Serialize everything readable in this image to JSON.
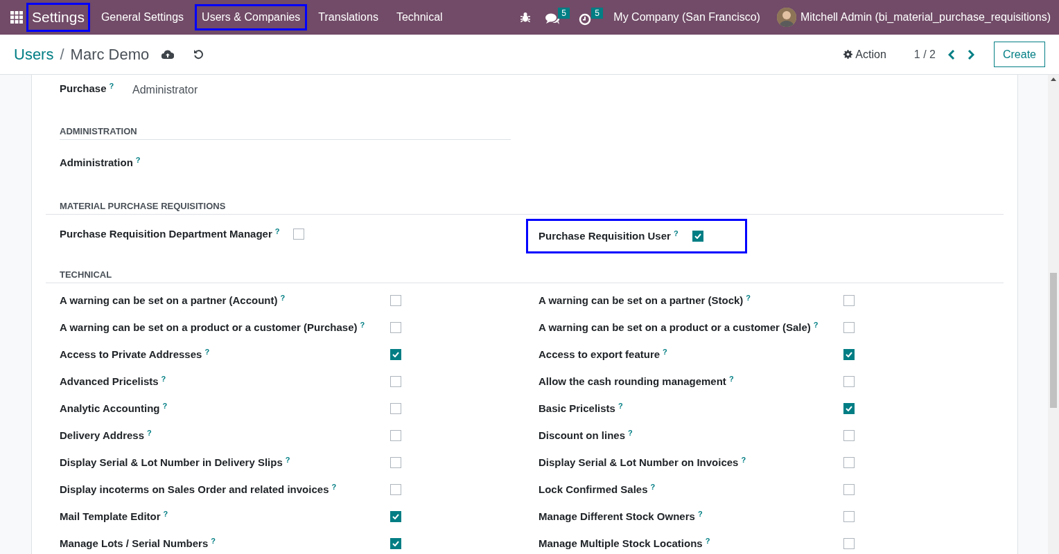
{
  "navbar": {
    "app": {
      "label": "Settings",
      "highlighted": true
    },
    "menu": [
      {
        "label": "General Settings",
        "highlighted": false
      },
      {
        "label": "Users & Companies",
        "highlighted": true
      },
      {
        "label": "Translations",
        "highlighted": false
      },
      {
        "label": "Technical",
        "highlighted": false
      }
    ],
    "messages_badge": "5",
    "activities_badge": "5",
    "company": "My Company (San Francisco)",
    "user": "Mitchell Admin (bi_material_purchase_requisitions)"
  },
  "control_panel": {
    "breadcrumb": [
      "Users",
      "Marc Demo"
    ],
    "separator": "/",
    "action": "Action",
    "pager": "1 / 2",
    "create": "Create"
  },
  "purchase": {
    "label": "Purchase",
    "help": "?",
    "value": "Administrator"
  },
  "administration": {
    "title": "ADMINISTRATION",
    "label": "Administration",
    "help": "?"
  },
  "material": {
    "title": "MATERIAL PURCHASE REQUISITIONS",
    "fields": [
      {
        "label": "Purchase Requisition Department Manager",
        "help": "?",
        "checked": false,
        "highlighted": false
      },
      {
        "label": "Purchase Requisition User",
        "help": "?",
        "checked": true,
        "highlighted": true
      }
    ]
  },
  "technical": {
    "title": "TECHNICAL",
    "fields": [
      {
        "label": "A warning can be set on a partner (Account)",
        "help": "?",
        "checked": false
      },
      {
        "label": "A warning can be set on a partner (Stock)",
        "help": "?",
        "checked": false
      },
      {
        "label": "A warning can be set on a product or a customer (Purchase)",
        "help": "?",
        "checked": false
      },
      {
        "label": "A warning can be set on a product or a customer (Sale)",
        "help": "?",
        "checked": false
      },
      {
        "label": "Access to Private Addresses",
        "help": "?",
        "checked": true
      },
      {
        "label": "Access to export feature",
        "help": "?",
        "checked": true
      },
      {
        "label": "Advanced Pricelists",
        "help": "?",
        "checked": false
      },
      {
        "label": "Allow the cash rounding management",
        "help": "?",
        "checked": false
      },
      {
        "label": "Analytic Accounting",
        "help": "?",
        "checked": false
      },
      {
        "label": "Basic Pricelists",
        "help": "?",
        "checked": true
      },
      {
        "label": "Delivery Address",
        "help": "?",
        "checked": false
      },
      {
        "label": "Discount on lines",
        "help": "?",
        "checked": false
      },
      {
        "label": "Display Serial & Lot Number in Delivery Slips",
        "help": "?",
        "checked": false
      },
      {
        "label": "Display Serial & Lot Number on Invoices",
        "help": "?",
        "checked": false
      },
      {
        "label": "Display incoterms on Sales Order and related invoices",
        "help": "?",
        "checked": false
      },
      {
        "label": "Lock Confirmed Sales",
        "help": "?",
        "checked": false
      },
      {
        "label": "Mail Template Editor",
        "help": "?",
        "checked": true
      },
      {
        "label": "Manage Different Stock Owners",
        "help": "?",
        "checked": false
      },
      {
        "label": "Manage Lots / Serial Numbers",
        "help": "?",
        "checked": true
      },
      {
        "label": "Manage Multiple Stock Locations",
        "help": "?",
        "checked": false
      }
    ]
  }
}
